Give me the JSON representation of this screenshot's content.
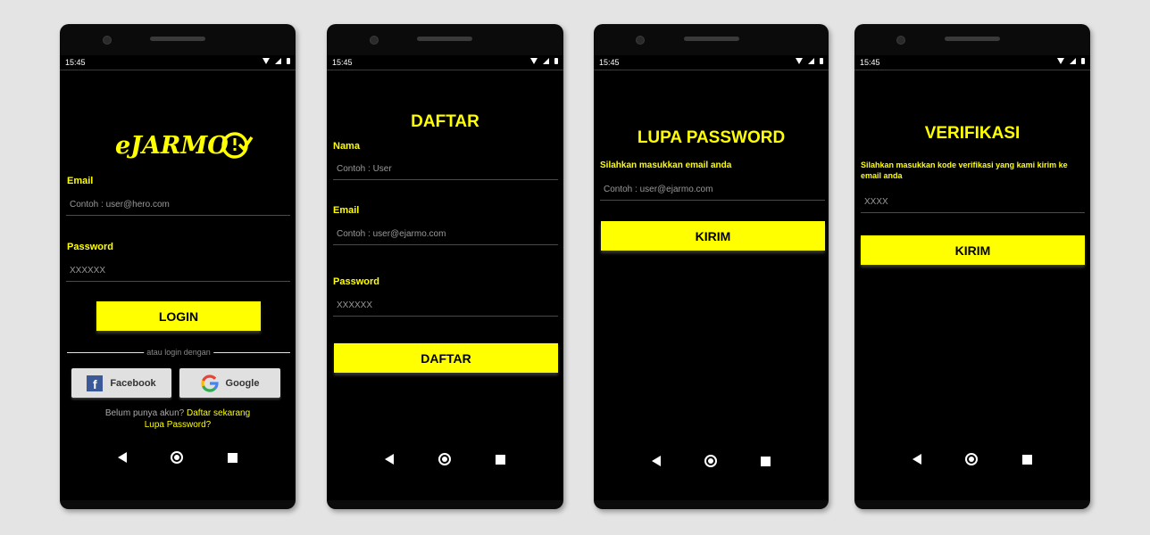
{
  "status": {
    "time": "15:45"
  },
  "login": {
    "logo": "eJARMO",
    "email_label": "Email",
    "email_placeholder": "Contoh : user@hero.com",
    "password_label": "Password",
    "password_placeholder": "XXXXXX",
    "login_button": "LOGIN",
    "divider_text": "atau login dengan",
    "facebook_button": "Facebook",
    "google_button": "Google",
    "register_prompt": "Belum punya akun?",
    "register_link": "Daftar sekarang",
    "forgot_link": "Lupa Password?"
  },
  "register": {
    "title": "DAFTAR",
    "name_label": "Nama",
    "name_placeholder": "Contoh : User",
    "email_label": "Email",
    "email_placeholder": "Contoh : user@ejarmo.com",
    "password_label": "Password",
    "password_placeholder": "XXXXXX",
    "submit_button": "DAFTAR"
  },
  "forgot": {
    "title": "LUPA PASSWORD",
    "instruction": "Silahkan masukkan email anda",
    "email_placeholder": "Contoh : user@ejarmo.com",
    "submit_button": "KIRIM"
  },
  "verify": {
    "title": "VERIFIKASI",
    "instruction": "Silahkan masukkan kode verifikasi yang kami kirim ke email anda",
    "code_placeholder": "XXXX",
    "submit_button": "KIRIM"
  },
  "colors": {
    "accent": "#ffff00",
    "background": "#000000"
  }
}
